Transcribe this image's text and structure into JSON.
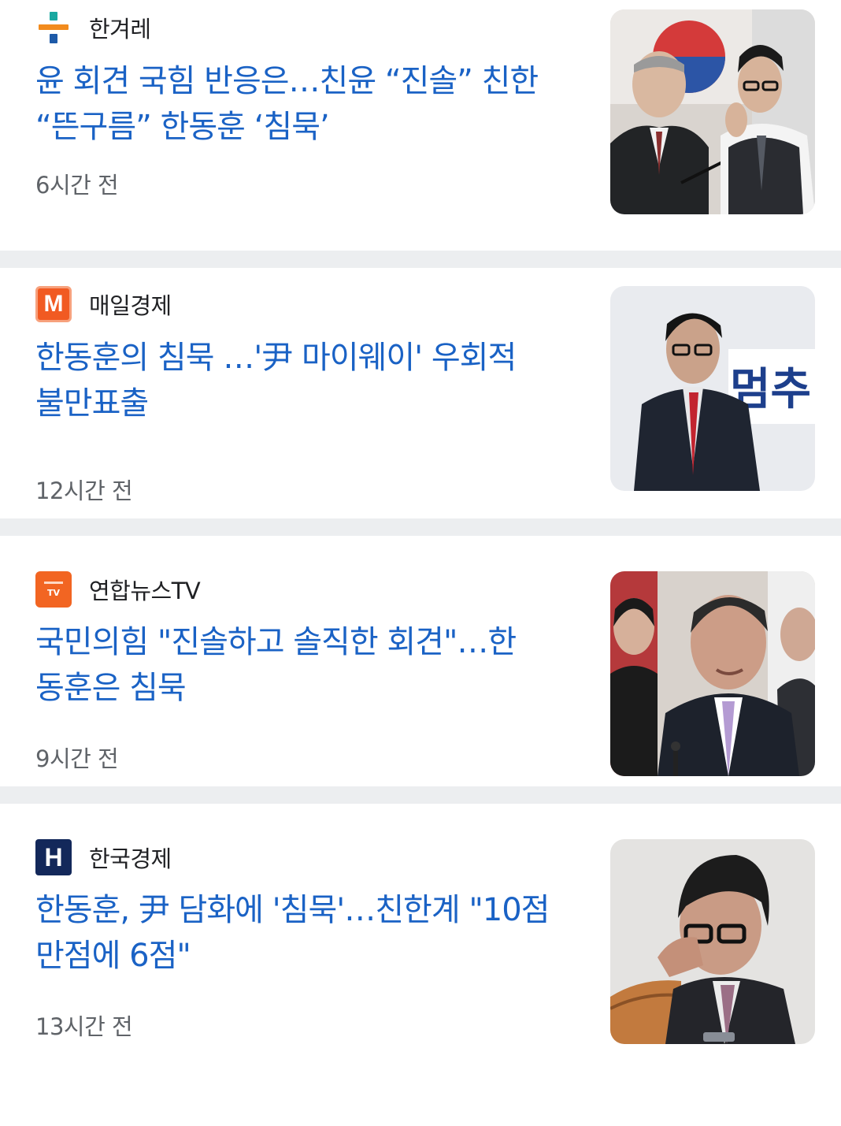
{
  "articles": [
    {
      "source": "한겨레",
      "logo_icon": "hani-logo-icon",
      "headline_line1": "윤 회견 국힘 반응은…친윤 “진솔” 친한",
      "headline_line2": "“뜬구름” 한동훈 ‘침묵’",
      "time": "6시간 전"
    },
    {
      "source": "매일경제",
      "logo_icon": "mk-logo-icon",
      "logo_letter": "M",
      "logo_color": "#f15a22",
      "headline_line1": "한동훈의 침묵 …'尹 마이웨이' 우회적",
      "headline_line2": "불만표출",
      "time": "12시간 전",
      "thumb_sign_text": "멈추"
    },
    {
      "source": "연합뉴스TV",
      "logo_icon": "yonhap-tv-logo-icon",
      "logo_color": "#f26522",
      "headline_line1": "국민의힘 \"진솔하고 솔직한 회견\"…한",
      "headline_line2": "동훈은 침묵",
      "time": "9시간 전"
    },
    {
      "source": "한국경제",
      "logo_icon": "hankyung-logo-icon",
      "logo_letter": "H",
      "logo_color": "#13285a",
      "headline_line1": "한동훈, 尹 담화에 '침묵'…친한계 \"10점",
      "headline_line2": "만점에 6점\"",
      "time": "13시간 전"
    }
  ],
  "colors": {
    "headline": "#1a62c5",
    "source_text": "#202124",
    "time_text": "#5f6368",
    "separator": "#eceef0"
  }
}
